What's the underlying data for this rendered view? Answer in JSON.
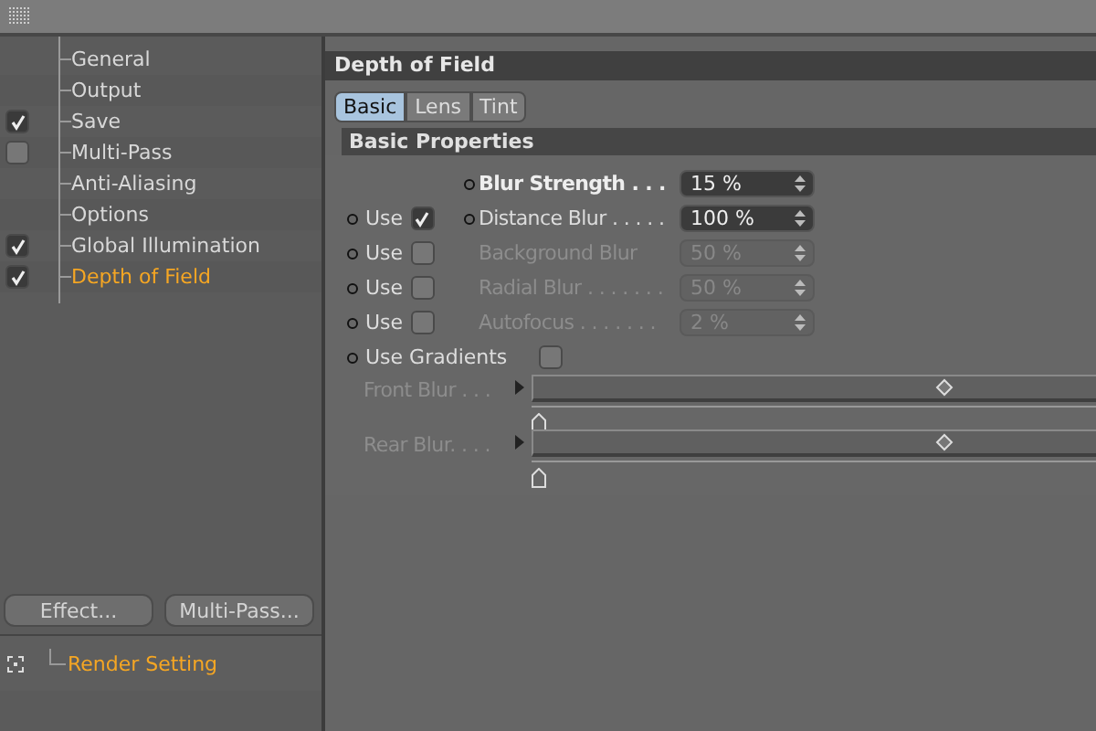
{
  "tree": {
    "items": [
      {
        "label": "General",
        "selected": false
      },
      {
        "label": "Output",
        "selected": false
      },
      {
        "label": "Save",
        "checked": true,
        "selected": false
      },
      {
        "label": "Multi-Pass",
        "checked": false,
        "selected": false
      },
      {
        "label": "Anti-Aliasing",
        "selected": false
      },
      {
        "label": "Options",
        "selected": false
      },
      {
        "label": "Global Illumination",
        "checked": true,
        "selected": false
      },
      {
        "label": "Depth of Field",
        "checked": true,
        "selected": true
      }
    ]
  },
  "buttons": [
    "Effect...",
    "Multi-Pass..."
  ],
  "render_setting": {
    "label": "Render Setting"
  },
  "panel": {
    "title": "Depth of Field",
    "tabs": [
      {
        "label": "Basic",
        "selected": true
      },
      {
        "label": "Lens",
        "selected": false
      },
      {
        "label": "Tint",
        "selected": false
      }
    ],
    "section": "Basic Properties",
    "rows": [
      {
        "kind": "field",
        "label": "Blur Strength . . .",
        "value": "15 %",
        "disabled": false,
        "emphasis": true
      },
      {
        "kind": "field",
        "use": {
          "label": "Use",
          "checked": true
        },
        "label": "Distance Blur . . . . .",
        "value": "100 %",
        "disabled": false,
        "emphasis": false
      },
      {
        "kind": "field",
        "use": {
          "label": "Use",
          "checked": false
        },
        "label": "Background Blur",
        "value": "50 %",
        "disabled": true,
        "emphasis": false
      },
      {
        "kind": "field",
        "use": {
          "label": "Use",
          "checked": false
        },
        "label": "Radial Blur . . . . . . .",
        "value": "50 %",
        "disabled": true,
        "emphasis": false
      },
      {
        "kind": "field",
        "use": {
          "label": "Use",
          "checked": false
        },
        "label": "Autofocus . . . . . . .",
        "value": "2 %",
        "disabled": true,
        "emphasis": false
      }
    ],
    "gradients": {
      "label": "Use Gradients",
      "checked": false,
      "items": [
        {
          "label": "Front Blur . . .",
          "level": 0.73
        },
        {
          "label": "Rear Blur. . . .",
          "level": 0.73
        }
      ]
    }
  }
}
